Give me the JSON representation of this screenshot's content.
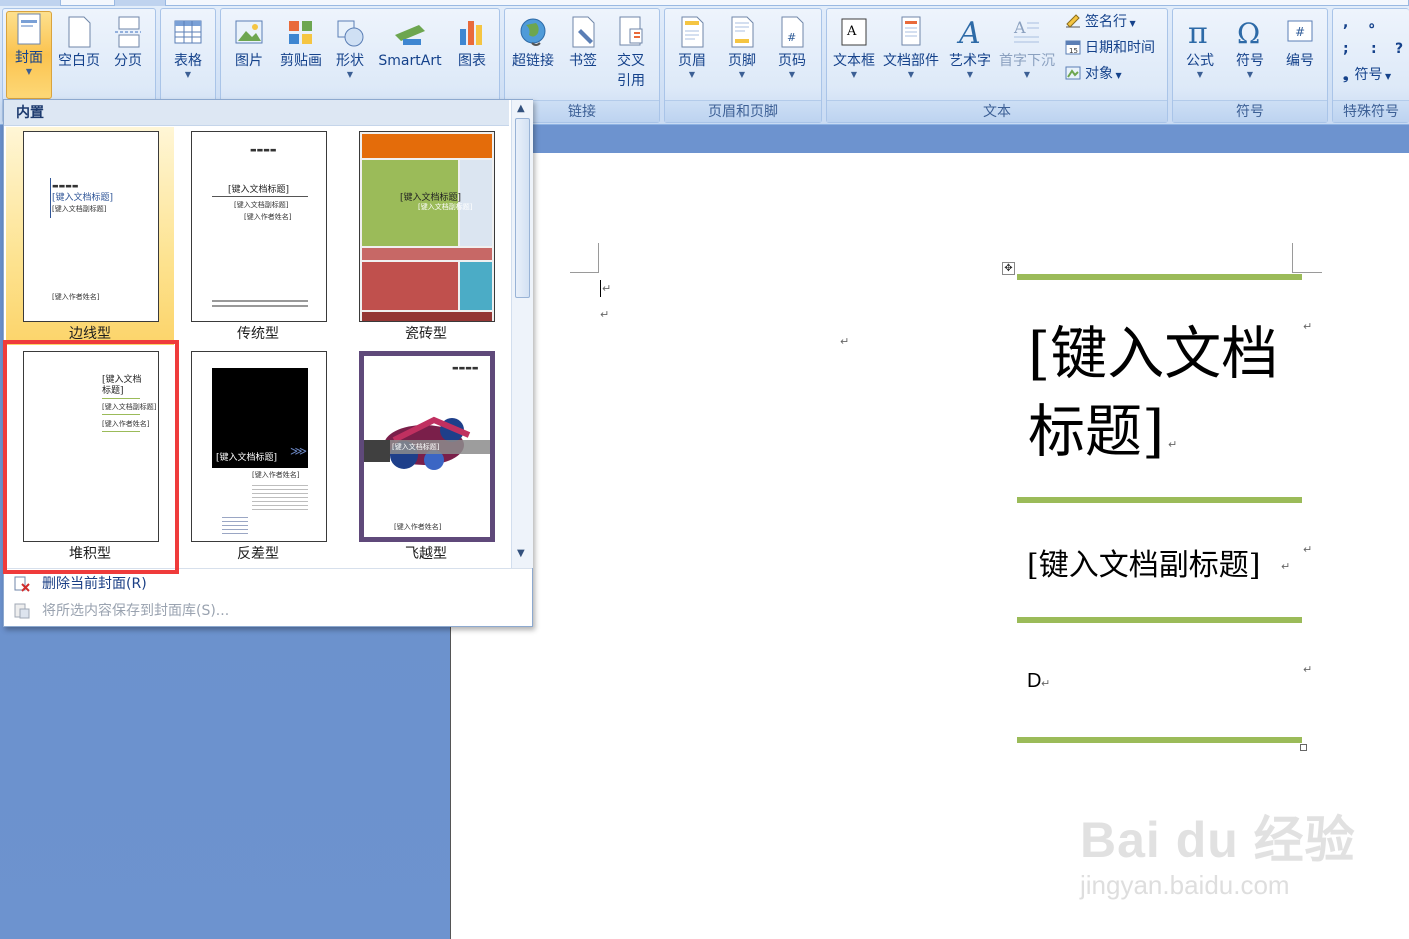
{
  "ribbon": {
    "groups": {
      "pages": {
        "cover": "封面",
        "blank": "空白页",
        "page_break": "分页"
      },
      "table": {
        "table": "表格"
      },
      "illustrations": {
        "picture": "图片",
        "clipart": "剪贴画",
        "shapes": "形状",
        "smartart": "SmartArt",
        "chart": "图表"
      },
      "links": {
        "label": "链接",
        "hyperlink": "超链接",
        "bookmark": "书签",
        "crossref_line1": "交叉",
        "crossref_line2": "引用"
      },
      "header_footer": {
        "label": "页眉和页脚",
        "header": "页眉",
        "footer": "页脚",
        "page_number": "页码"
      },
      "text": {
        "label": "文本",
        "textbox": "文本框",
        "quickparts": "文档部件",
        "wordart": "艺术字",
        "dropcap": "首字下沉",
        "signature": "签名行",
        "datetime": "日期和时间",
        "object": "对象"
      },
      "symbols": {
        "label": "符号",
        "equation": "公式",
        "symbol": "符号",
        "numbering": "编号"
      },
      "special": {
        "label": "特殊符号",
        "symbol": "符号",
        "glyphs": [
          ",",
          "。",
          ";",
          ":",
          "?"
        ]
      }
    }
  },
  "gallery": {
    "section": "内置",
    "tiles": [
      {
        "label": "边线型"
      },
      {
        "label": "传统型"
      },
      {
        "label": "瓷砖型"
      },
      {
        "label": "堆积型"
      },
      {
        "label": "反差型"
      },
      {
        "label": "飞越型"
      }
    ],
    "thumb_text": {
      "title": "[键入文档标题]",
      "subtitle": "[键入文档副标题]",
      "stack_title_1": "[键入文档",
      "stack_title_2": "标题]",
      "author": "[键入作者姓名]"
    },
    "menu": {
      "delete": "删除当前封面(R)",
      "save": "将所选内容保存到封面库(S)..."
    }
  },
  "document": {
    "title": "[键入文档标题]",
    "subtitle": "[键入文档副标题]",
    "field": "D",
    "accent_color": "#9bbb59"
  },
  "watermark": {
    "brand": "Bai du 经验",
    "url": "jingyan.baidu.com"
  }
}
